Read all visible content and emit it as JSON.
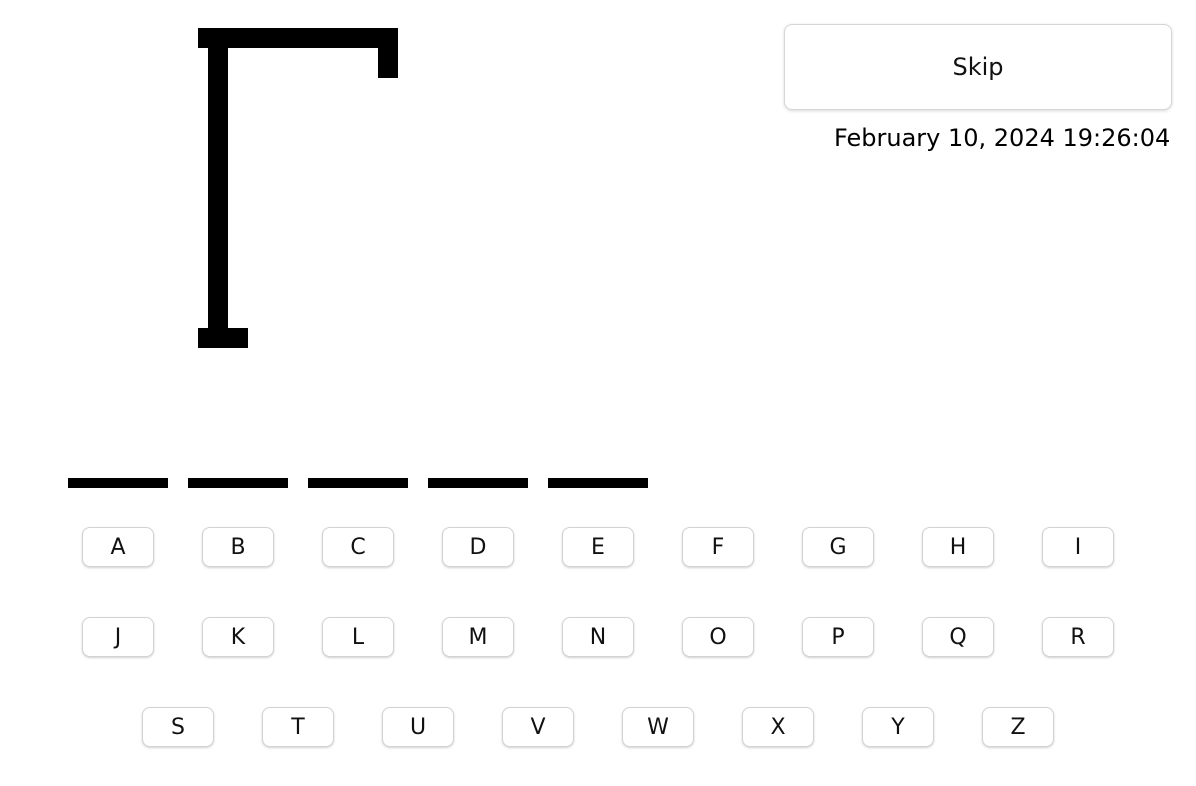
{
  "controls": {
    "skip_label": "Skip"
  },
  "status": {
    "datetime": "February 10, 2024 19:26:04"
  },
  "word": {
    "letter_count": 5,
    "revealed": [
      "",
      "",
      "",
      "",
      ""
    ]
  },
  "keyboard": {
    "rows": [
      [
        "A",
        "B",
        "C",
        "D",
        "E",
        "F",
        "G",
        "H",
        "I"
      ],
      [
        "J",
        "K",
        "L",
        "M",
        "N",
        "O",
        "P",
        "Q",
        "R"
      ],
      [
        "S",
        "T",
        "U",
        "V",
        "W",
        "X",
        "Y",
        "Z"
      ]
    ]
  }
}
